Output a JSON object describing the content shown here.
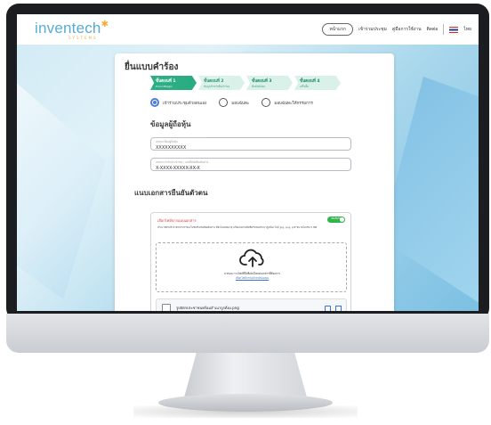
{
  "header": {
    "logo_text": "inventech",
    "logo_sub": "SYSTEMS",
    "nav_home": "หน้าแรก",
    "nav_meeting": "เข้าร่วมประชุม",
    "nav_manual": "คู่มือการใช้งาน",
    "nav_contact": "ติดต่อ",
    "nav_lang": "ไทย"
  },
  "form": {
    "title": "ยื่นแบบคำร้อง",
    "steps": [
      {
        "label": "ขั้นตอนที่ 1",
        "sub": "Form Margin"
      },
      {
        "label": "ขั้นตอนที่ 2",
        "sub": "ข้อมูลสำหรับยื่นคำร้อง"
      },
      {
        "label": "ขั้นตอนที่ 3",
        "sub": "ยืนยันตัวตน"
      },
      {
        "label": "ขั้นตอนที่ 4",
        "sub": "เสร็จสิ้น"
      }
    ],
    "radios": [
      {
        "label": "เข้าร่วมประชุมด้วยตนเอง",
        "selected": true
      },
      {
        "label": "มอบฉันทะ",
        "selected": false
      },
      {
        "label": "มอบฉันทะให้กรรมการ",
        "selected": false
      }
    ],
    "shareholder_heading": "ข้อมูลผู้ถือหุ้น",
    "field1_placeholder": "เลขทะเบียนผู้ถือหุ้น",
    "field1_value": "XXXXXXXXXX",
    "field2_placeholder": "เลขประจำตัวประชาชน / เลขที่หนังสือเดินทาง",
    "field2_value": "X-XXXX-XXXXX-XX-X",
    "doc_heading": "แนบเอกสารยืนยันตัวตน",
    "upload": {
      "title": "เลือกไฟล์จากแบบเอกสาร",
      "toggle": "เปิด/ปิดใช้",
      "description": "สำเนาบัตรประจำตัวประชาชน/ใบขับขี่/หนังสือเดินทาง ที่ยังไม่หมดอายุ พร้อมลงลายมือชื่อรับรองสำเนาถูกต้อง ไฟล์ jpg, png, pdf ขนาดไม่เกิน 5 MB",
      "drop_text": "ลากและวางไฟล์ที่นี่เพื่ออัปโหลดเอกสารที่ต้องการ",
      "drop_link": "เลือกไฟล์จากอุปกรณ์ของคุณ",
      "file_name": "รูปบัตรประชาชนพร้อมสำเนาถูกต้อง.png"
    }
  },
  "colors": {
    "accent": "#1aa679",
    "brand": "#3a9ccf",
    "radio": "#3c72d6"
  }
}
